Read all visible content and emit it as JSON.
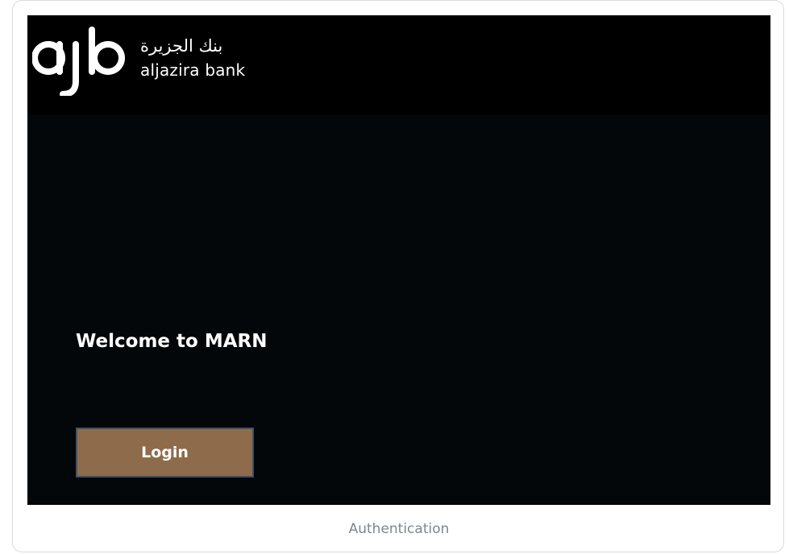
{
  "brand": {
    "logo_mark": "ajb",
    "name_ar": "بنك الجزيرة",
    "name_en": "aljazira bank",
    "bar_color": "#000000"
  },
  "main": {
    "welcome_text": "Welcome to MARN",
    "login_label": "Login",
    "background_color": "#03070a",
    "button_color": "#8d6b4b"
  },
  "caption": "Authentication"
}
